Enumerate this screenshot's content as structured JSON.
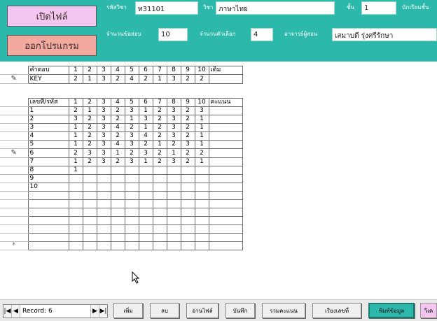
{
  "header": {
    "open_file_label": "เปิดไฟล์",
    "exit_label": "ออกโปรแกรม",
    "subject_code_label": "รหัสวิชา",
    "subject_code_value": "ท31101",
    "subject_label": "วิชา",
    "subject_value": "ภาษาไทย",
    "class_label": "ชั้น",
    "class_value": "1",
    "extra_label": "นักเรียนชั้น",
    "num_questions_label": "จำนวนข้อสอบ",
    "num_questions_value": "10",
    "num_choices_label": "จำนวนตัวเลือก",
    "num_choices_value": "4",
    "teacher_label": "อาจารย์ผู้สอน",
    "teacher_value": "เสมาบดี รุ่งศรีรักษา"
  },
  "key_table": {
    "label_header": "คำตอบ",
    "total_header": "เต็ม",
    "columns": [
      "1",
      "2",
      "3",
      "4",
      "5",
      "6",
      "7",
      "8",
      "9",
      "10"
    ],
    "row_label": "KEY",
    "row_values": [
      "2",
      "1",
      "3",
      "2",
      "4",
      "2",
      "1",
      "3",
      "2",
      "2"
    ]
  },
  "answer_table": {
    "label_header": "เลขที่/รหัส",
    "total_header": "คะแนน",
    "columns": [
      "1",
      "2",
      "3",
      "4",
      "5",
      "6",
      "7",
      "8",
      "9",
      "10"
    ],
    "rows": [
      {
        "id": "1",
        "values": [
          "2",
          "1",
          "3",
          "2",
          "3",
          "1",
          "2",
          "3",
          "2",
          "3"
        ]
      },
      {
        "id": "2",
        "values": [
          "3",
          "2",
          "3",
          "2",
          "1",
          "3",
          "2",
          "3",
          "2",
          "1"
        ]
      },
      {
        "id": "3",
        "values": [
          "1",
          "2",
          "3",
          "4",
          "2",
          "1",
          "2",
          "3",
          "2",
          "1"
        ]
      },
      {
        "id": "4",
        "values": [
          "1",
          "2",
          "3",
          "2",
          "3",
          "4",
          "2",
          "3",
          "2",
          "1"
        ]
      },
      {
        "id": "5",
        "values": [
          "1",
          "2",
          "3",
          "4",
          "3",
          "2",
          "1",
          "2",
          "3",
          "1"
        ]
      },
      {
        "id": "6",
        "values": [
          "2",
          "3",
          "3",
          "1",
          "2",
          "3",
          "2",
          "1",
          "2",
          "2"
        ]
      },
      {
        "id": "7",
        "values": [
          "1",
          "2",
          "3",
          "2",
          "3",
          "1",
          "2",
          "3",
          "2",
          "1"
        ]
      },
      {
        "id": "8",
        "values": [
          "1",
          "",
          "",
          "",
          "",
          "",
          "",
          "",
          "",
          ""
        ]
      },
      {
        "id": "9",
        "values": [
          "",
          "",
          "",
          "",
          "",
          "",
          "",
          "",
          "",
          ""
        ]
      },
      {
        "id": "10",
        "values": [
          "",
          "",
          "",
          "",
          "",
          "",
          "",
          "",
          "",
          ""
        ]
      }
    ],
    "new_row_marker": "*"
  },
  "record_nav": {
    "record_label": "Record: 6"
  },
  "buttons": {
    "add": "เพิ่ม",
    "delete": "ลบ",
    "read_file": "อ่านไฟล์",
    "save": "บันทึก",
    "sum_score": "รวมคะแนน",
    "sort": "เรียงเลขที่",
    "print": "พิมพ์ข้อมูล",
    "extra": "วิเค"
  },
  "icons": {
    "pencil": "pencil-icon",
    "first": "first-record-icon",
    "prev": "prev-record-icon",
    "next": "next-record-icon",
    "last": "last-record-icon"
  }
}
